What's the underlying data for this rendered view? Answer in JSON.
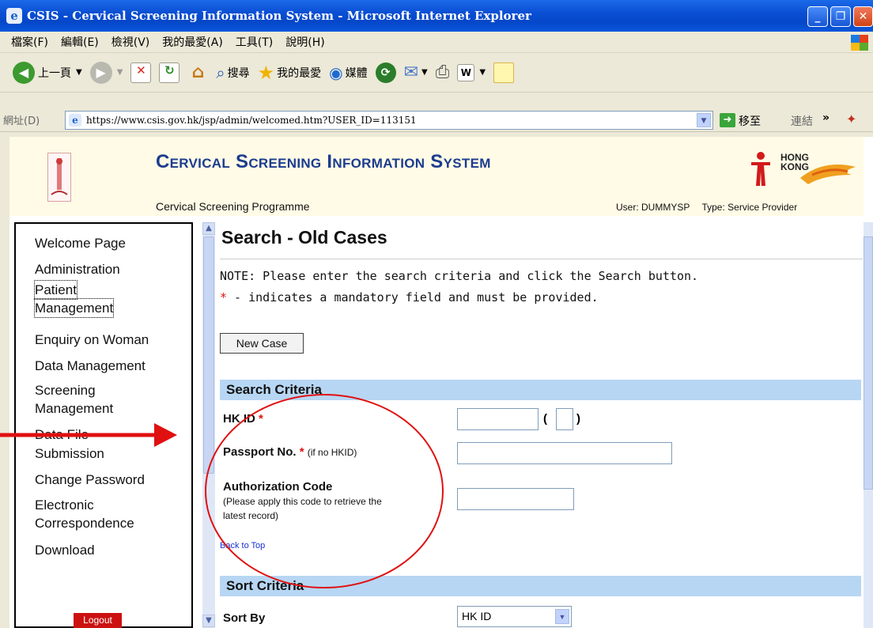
{
  "browser": {
    "title": "CSIS - Cervical Screening Information System - Microsoft Internet Explorer",
    "menu": [
      "檔案(F)",
      "編輯(E)",
      "檢視(V)",
      "我的最愛(A)",
      "工具(T)",
      "說明(H)"
    ],
    "toolbar": {
      "back": "上一頁",
      "search": "搜尋",
      "favorites": "我的最愛",
      "media": "媒體"
    },
    "address_label": "網址(D)",
    "url": "https://www.csis.gov.hk/jsp/admin/welcomed.htm?USER_ID=113151",
    "go_label": "移至",
    "links_label": "連結"
  },
  "banner": {
    "title": "Cervical Screening Information System",
    "subtitle": "Cervical Screening Programme",
    "user_label": "User: DUMMYSP",
    "type_label": "Type: Service Provider",
    "hk_logo_text": [
      "HONG",
      "KONG"
    ]
  },
  "sidebar": {
    "items": [
      "Welcome Page",
      "Administration",
      "Patient",
      "Management",
      "Enquiry on Woman",
      "Data Management",
      "Screening",
      "Management",
      "Data File",
      "Submission",
      "Change Password",
      "Electronic",
      "Correspondence",
      "Download"
    ],
    "logout": "Logout"
  },
  "page": {
    "heading": "Search - Old Cases",
    "note": "NOTE: Please enter the search criteria and click the Search button.",
    "required_star": "*",
    "required_note": " - indicates a mandatory field and must be provided.",
    "new_case_button": "New Case",
    "search_section": "Search Criteria",
    "fields": {
      "hkid_label": "HK ID",
      "hkid_paren_open": "(",
      "hkid_paren_close": ")",
      "passport_label": "Passport No.",
      "passport_hint": "(if no HKID)",
      "auth_label": "Authorization Code",
      "auth_hint_line1": "(Please apply this code to retrieve the",
      "auth_hint_line2": "latest record)"
    },
    "back_to_top": "Back to Top",
    "sort_section": "Sort Criteria",
    "sort_by_label": "Sort By",
    "sort_by_value": "HK ID"
  },
  "colors": {
    "titlebar": "#0a4fd4",
    "section_bar": "#b7d6f3",
    "site_title": "#1b3c8f",
    "annotation_red": "#e01010"
  }
}
